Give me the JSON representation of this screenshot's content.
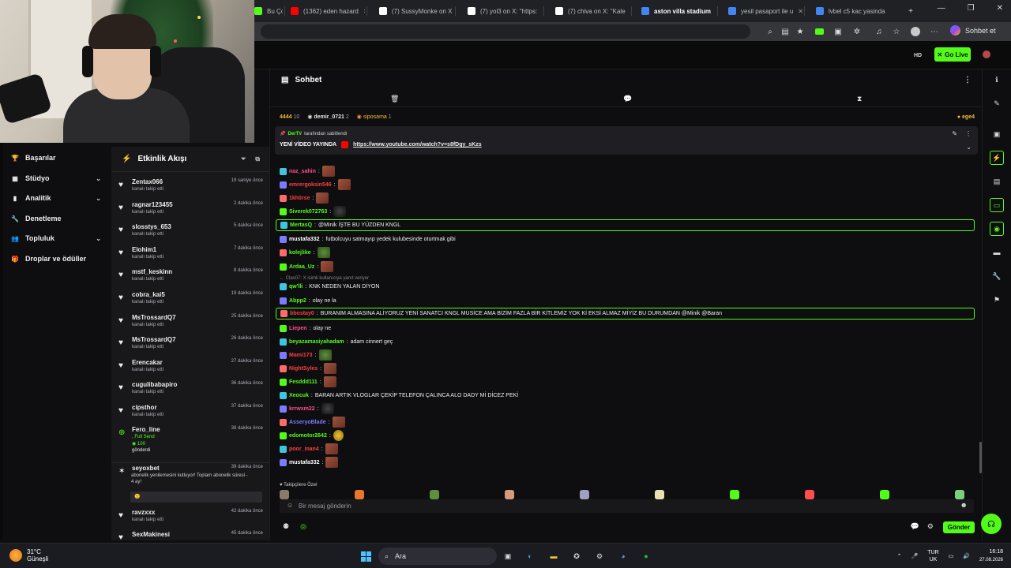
{
  "browser": {
    "tabs": [
      {
        "label": "Bu Ço",
        "color": "#53fc18",
        "active": false
      },
      {
        "label": "(1362) eden hazard",
        "color": "#ff0000",
        "active": false
      },
      {
        "label": "(7) SussyMonke on X",
        "color": "#ffffff",
        "active": false
      },
      {
        "label": "(7) yol3 on X: \"https:",
        "color": "#ffffff",
        "active": false
      },
      {
        "label": "(7) chiva on X: \"Kale",
        "color": "#ffffff",
        "active": false
      },
      {
        "label": "aston villa stadium",
        "color": "#4285f4",
        "active": true
      },
      {
        "label": "yesil pasaport ile u",
        "color": "#4285f4",
        "active": false
      },
      {
        "label": "lvbel c5 kac yasinda",
        "color": "#4285f4",
        "active": false
      }
    ],
    "new_tab": "+",
    "window_controls": [
      "—",
      "❐",
      "✕"
    ],
    "toolbar_action": "Sohbet et"
  },
  "kick": {
    "go_live": "Go Live",
    "hd_badge": "HD"
  },
  "sidebar": {
    "items": [
      {
        "label": "Başarılar",
        "icon": "trophy-icon",
        "glyph": "🏆",
        "chevron": false
      },
      {
        "label": "Stüdyo",
        "icon": "studio-icon",
        "glyph": "▦",
        "chevron": true
      },
      {
        "label": "Analitik",
        "icon": "chart-icon",
        "glyph": "▮",
        "chevron": true
      },
      {
        "label": "Denetleme",
        "icon": "wrench-icon",
        "glyph": "🔧",
        "chevron": false
      },
      {
        "label": "Topluluk",
        "icon": "community-icon",
        "glyph": "👥",
        "chevron": true
      },
      {
        "label": "Droplar ve ödüller",
        "icon": "gift-icon",
        "glyph": "🎁",
        "chevron": false
      }
    ]
  },
  "activity": {
    "title": "Etkinlik Akışı",
    "rows": [
      {
        "user": "Zentax066",
        "sub": "kanalı takip etti",
        "time": "19 saniye önce"
      },
      {
        "user": "ragnar123455",
        "sub": "kanalı takip etti",
        "time": "2 dakika önce"
      },
      {
        "user": "slosstys_653",
        "sub": "kanalı takip etti",
        "time": "5 dakika önce"
      },
      {
        "user": "Elohim1",
        "sub": "kanalı takip etti",
        "time": "7 dakika önce"
      },
      {
        "user": "mstf_keskinn",
        "sub": "kanalı takip etti",
        "time": "8 dakika önce"
      },
      {
        "user": "cobra_kai5",
        "sub": "kanalı takip etti",
        "time": "19 dakika önce"
      },
      {
        "user": "MsTrossardQ7",
        "sub": "kanalı takip etti",
        "time": "25 dakika önce"
      },
      {
        "user": "MsTrossardQ7",
        "sub": "kanalı takip etti",
        "time": "26 dakika önce"
      },
      {
        "user": "Erencakar",
        "sub": "kanalı takip etti",
        "time": "27 dakika önce"
      },
      {
        "user": "cugulibabapiro",
        "sub": "kanalı takip etti",
        "time": "36 dakika önce"
      },
      {
        "user": "cipsthor",
        "sub": "kanalı takip etti",
        "time": "37 dakika önce"
      }
    ],
    "gift": {
      "user": "Fero_line",
      "line1": ", Full Send",
      "amount": "100",
      "amount_label": "gönderdi",
      "time": "38 dakika önce"
    },
    "renew": {
      "user": "seyoxbet",
      "note": "abonelik yenilemesini kutluyor! Toplam abonelik süresi - 4 ay!",
      "box": "😐",
      "time": "39 dakika önce"
    },
    "tail": [
      {
        "user": "ravzxxx",
        "sub": "kanalı takip etti",
        "time": "42 dakika önce"
      },
      {
        "user": "SexMakinesi",
        "sub": "",
        "time": "45 dakika önce"
      }
    ]
  },
  "chat": {
    "title": "Sohbet",
    "gifters": {
      "first_amount": "4444",
      "first_count": "10",
      "second_user": "demir_0721",
      "second_count": "2",
      "third_user": "siposama",
      "third_count": "1",
      "right_user": "ege4"
    },
    "pinned": {
      "by_user": "DerTV",
      "by_text": "tarafından sabitlendi",
      "label": "YENİ VİDEO YAYINDA",
      "link": "https://www.youtube.com/watch?v=s8fDgy_sKzs"
    },
    "messages": [
      {
        "user": "naz_sahin",
        "color": "#ff4d8f",
        "text": "",
        "emote": "red"
      },
      {
        "user": "emrergoksin546",
        "color": "#ff3f3f",
        "text": "",
        "emote": "red"
      },
      {
        "user": "1kh0rse",
        "color": "#ff3f3f",
        "text": "",
        "emote": "red"
      },
      {
        "user": "Siverek072763",
        "color": "#53fc18",
        "text": "",
        "emote": "dark"
      },
      {
        "user": "MertasQ",
        "color": "#53fc18",
        "text": "@Minik İŞTE BU YÜZDEN KNGL",
        "emote": ""
      },
      {
        "user": "mustafa332",
        "color": "#ffffff",
        "text": "futbolcuyu satmayıp yedek kulubesinde oturtmak gibi",
        "emote": ""
      },
      {
        "user": "kolejlike",
        "color": "#53fc18",
        "text": "",
        "emote": "green"
      },
      {
        "user": "Ardaa_Uz",
        "color": "#53fc18",
        "text": "",
        "emote": "red"
      },
      {
        "user": "qw'lli",
        "color": "#53fc18",
        "text": "KNK NEDEN YALAN DİYON",
        "emote": ""
      },
      {
        "user": "Abpp2",
        "color": "#53fc18",
        "text": "olay ne la",
        "emote": ""
      },
      {
        "user": "bbostay0",
        "color": "#ff3f3f",
        "text": "BURANIM ALMASINA ALİYORUZ YENİ SANATCI KNGL MUSİCE AMA BİZİM FAZLA BİR KİTLEMİZ YOK Kİ EKSİ ALMAZ MİYİZ BU DURUMDAN @Minik @Baran",
        "emote": ""
      },
      {
        "user": "Liepen",
        "color": "#ff4d8f",
        "text": "olay ne",
        "emote": ""
      },
      {
        "user": "beyazamasiyahadam",
        "color": "#53fc18",
        "text": "adam cinnert geç",
        "emote": ""
      },
      {
        "user": "Mami173",
        "color": "#ff3f3f",
        "text": "",
        "emote": "green"
      },
      {
        "user": "NightSyles",
        "color": "#ff3f3f",
        "text": "",
        "emote": "red"
      },
      {
        "user": "Fesddd111",
        "color": "#53fc18",
        "text": "",
        "emote": "red"
      },
      {
        "user": "Xeocuk",
        "color": "#53fc18",
        "text": "BARAN ARTIK VLOGLAR ÇEKİP TELEFON ÇALINCA ALO DADY Mİ DİCEZ PEKİ",
        "emote": ""
      },
      {
        "user": "krrwxm22",
        "color": "#ff4d8f",
        "text": "",
        "emote": "dark"
      },
      {
        "user": "AsseryoBlade",
        "color": "#7b7bff",
        "text": "",
        "emote": "red"
      },
      {
        "user": "edomotor2642",
        "color": "#53fc18",
        "text": "",
        "emote": "yellow"
      },
      {
        "user": "poor_man4",
        "color": "#ff3f3f",
        "text": "",
        "emote": "red"
      },
      {
        "user": "mustafa332",
        "color": "#ffffff",
        "text": "",
        "emote": "red"
      }
    ],
    "reply_note": "← Clas07: X isimli kullanıcıya yanıt veriyor",
    "emote_label": "♥ Takipçilere Özel",
    "input_placeholder": "Bir mesaj gönderin",
    "send_label": "Gönder"
  },
  "taskbar": {
    "temperature": "31°C",
    "weather_text": "Güneşli",
    "search_label": "Ara",
    "lang_top": "TUR",
    "lang_bottom": "UK",
    "time": "16:18",
    "date": "27.08.2026"
  }
}
